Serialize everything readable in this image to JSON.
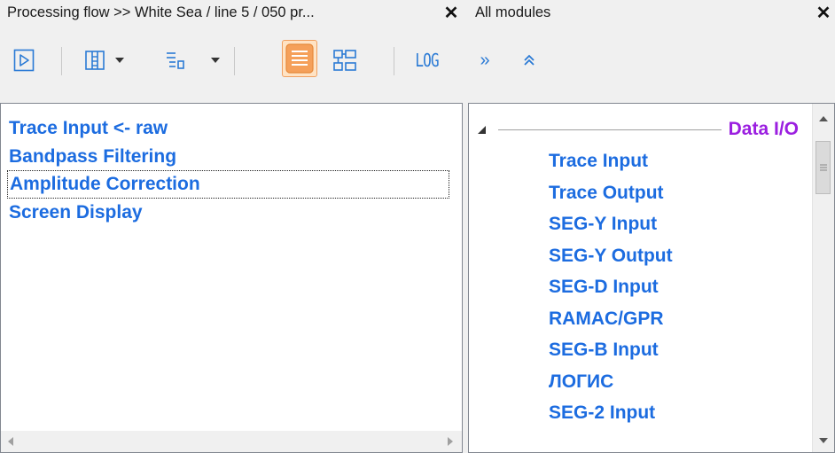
{
  "flow_panel": {
    "title": "Processing flow >> White Sea / line 5 / 050 pr...",
    "close": "✕",
    "toolbar": {
      "run": "run-icon",
      "frames": "frames-icon",
      "frames_menu": "dropdown-arrow-icon",
      "levels": "levels-icon",
      "levels_menu": "dropdown-arrow-icon",
      "list_view": "list-view-icon",
      "tree_view": "tree-view-icon",
      "log_label": "LOG",
      "accent": "#f5a05a"
    },
    "items": [
      {
        "label": "Trace Input <- raw"
      },
      {
        "label": "Bandpass Filtering"
      },
      {
        "label": "Amplitude Correction",
        "selected": true
      },
      {
        "label": "Screen Display"
      }
    ]
  },
  "modules_panel": {
    "title": "All modules",
    "close": "✕",
    "toolbar": {
      "expand_all": "»",
      "collapse_all": "⌃"
    },
    "group": {
      "label": "Data I/O",
      "expander": "◢"
    },
    "modules": [
      "Trace Input",
      "Trace Output",
      "SEG-Y Input",
      "SEG-Y Output",
      "SEG-D Input",
      "RAMAC/GPR",
      "SEG-B Input",
      "ЛОГИС",
      "SEG-2 Input"
    ]
  },
  "colors": {
    "module_text": "#1c6ce0",
    "group_text": "#9b1fe0",
    "icon_blue": "#2a7ad5"
  }
}
